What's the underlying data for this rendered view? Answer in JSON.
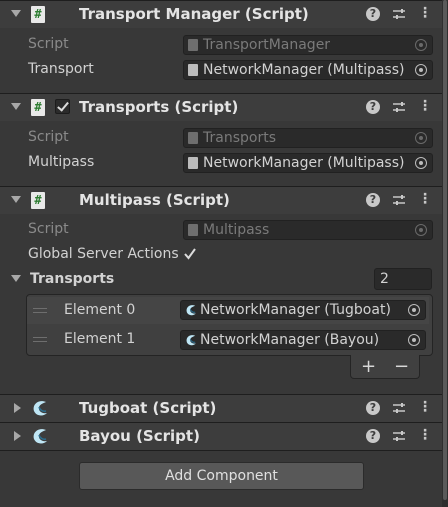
{
  "components": [
    {
      "title": "Transport Manager (Script)",
      "fields": [
        {
          "label": "Script",
          "value": "TransportManager"
        },
        {
          "label": "Transport",
          "value": "NetworkManager (Multipass)"
        }
      ]
    },
    {
      "title": "Transports (Script)",
      "enabled": true,
      "fields": [
        {
          "label": "Script",
          "value": "Transports"
        },
        {
          "label": "Multipass",
          "value": "NetworkManager (Multipass)"
        }
      ]
    },
    {
      "title": "Multipass (Script)",
      "fields": [
        {
          "label": "Script",
          "value": "Multipass"
        }
      ],
      "global_server_actions_label": "Global Server Actions",
      "global_server_actions_checked": true,
      "transports_label": "Transports",
      "transports_size": "2",
      "elements": [
        {
          "label": "Element 0",
          "value": "NetworkManager (Tugboat)"
        },
        {
          "label": "Element 1",
          "value": "NetworkManager (Bayou)"
        }
      ],
      "add_label": "+",
      "remove_label": "−"
    },
    {
      "title": "Tugboat (Script)"
    },
    {
      "title": "Bayou (Script)"
    }
  ],
  "header_icons": {
    "help": "?",
    "menu": "⋮"
  },
  "add_component_label": "Add Component",
  "icons": {
    "script": "cs-script-icon",
    "custom_script": "fishnet-bird-icon",
    "fold_open": "chevron-down-icon",
    "fold_closed": "chevron-right-icon",
    "help": "help-icon",
    "preset": "preset-icon",
    "menu": "kebab-menu-icon",
    "object_picker": "object-picker-icon"
  },
  "colors": {
    "background": "#383838",
    "header": "#3d3d3d",
    "field": "#2a2a2a",
    "text": "#d2d2d2"
  }
}
